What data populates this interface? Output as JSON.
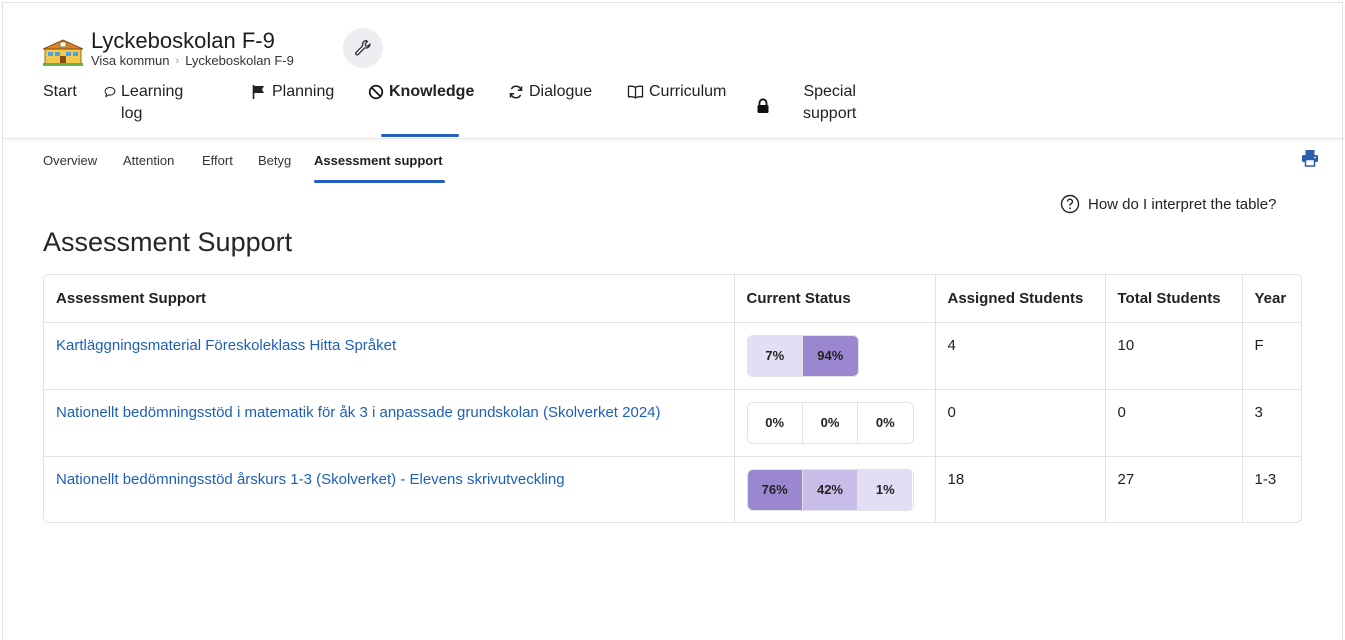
{
  "school": {
    "name": "Lyckeboskolan F-9",
    "breadcrumb": [
      "Visa kommun",
      "Lyckeboskolan F-9"
    ]
  },
  "nav": [
    {
      "label": "Start",
      "icon": ""
    },
    {
      "label": "Learning log",
      "icon": "speech-bubble-icon"
    },
    {
      "label": "Planning",
      "icon": "flag-icon"
    },
    {
      "label": "Knowledge",
      "icon": "knowledge-icon",
      "active": true
    },
    {
      "label": "Dialogue",
      "icon": "refresh-icon"
    },
    {
      "label": "Curriculum",
      "icon": "book-icon"
    },
    {
      "label": "",
      "icon": "lock-icon"
    },
    {
      "label_line1": "Special",
      "label_line2": "support"
    }
  ],
  "subnav": [
    "Overview",
    "Attention",
    "Effort",
    "Betyg",
    "Assessment support"
  ],
  "help": {
    "label": "How do I interpret the table?"
  },
  "page_title": "Assessment Support",
  "table": {
    "headers": [
      "Assessment Support",
      "Current Status",
      "Assigned Students",
      "Total Students",
      "Year"
    ],
    "rows": [
      {
        "name": "Kartläggningsmaterial Föreskoleklass Hitta Språket",
        "status": [
          "7%",
          "94%"
        ],
        "assigned": "4",
        "total": "10",
        "year": "F"
      },
      {
        "name": "Nationellt bedömningsstöd i matematik för åk 3 i anpassade grundskolan (Skolverket 2024)",
        "status": [
          "0%",
          "0%",
          "0%"
        ],
        "assigned": "0",
        "total": "0",
        "year": "3"
      },
      {
        "name": "Nationellt bedömningsstöd årskurs 1-3 (Skolverket) - Elevens skrivutveckling",
        "status": [
          "76%",
          "42%",
          "1%"
        ],
        "assigned": "18",
        "total": "27",
        "year": "1-3"
      }
    ]
  },
  "colors": {
    "accent": "#2260c0",
    "link": "#1f5fb8",
    "violet_dark": "#9b87cf",
    "violet_mid": "#c8bde8",
    "violet_light": "#e3def3"
  }
}
